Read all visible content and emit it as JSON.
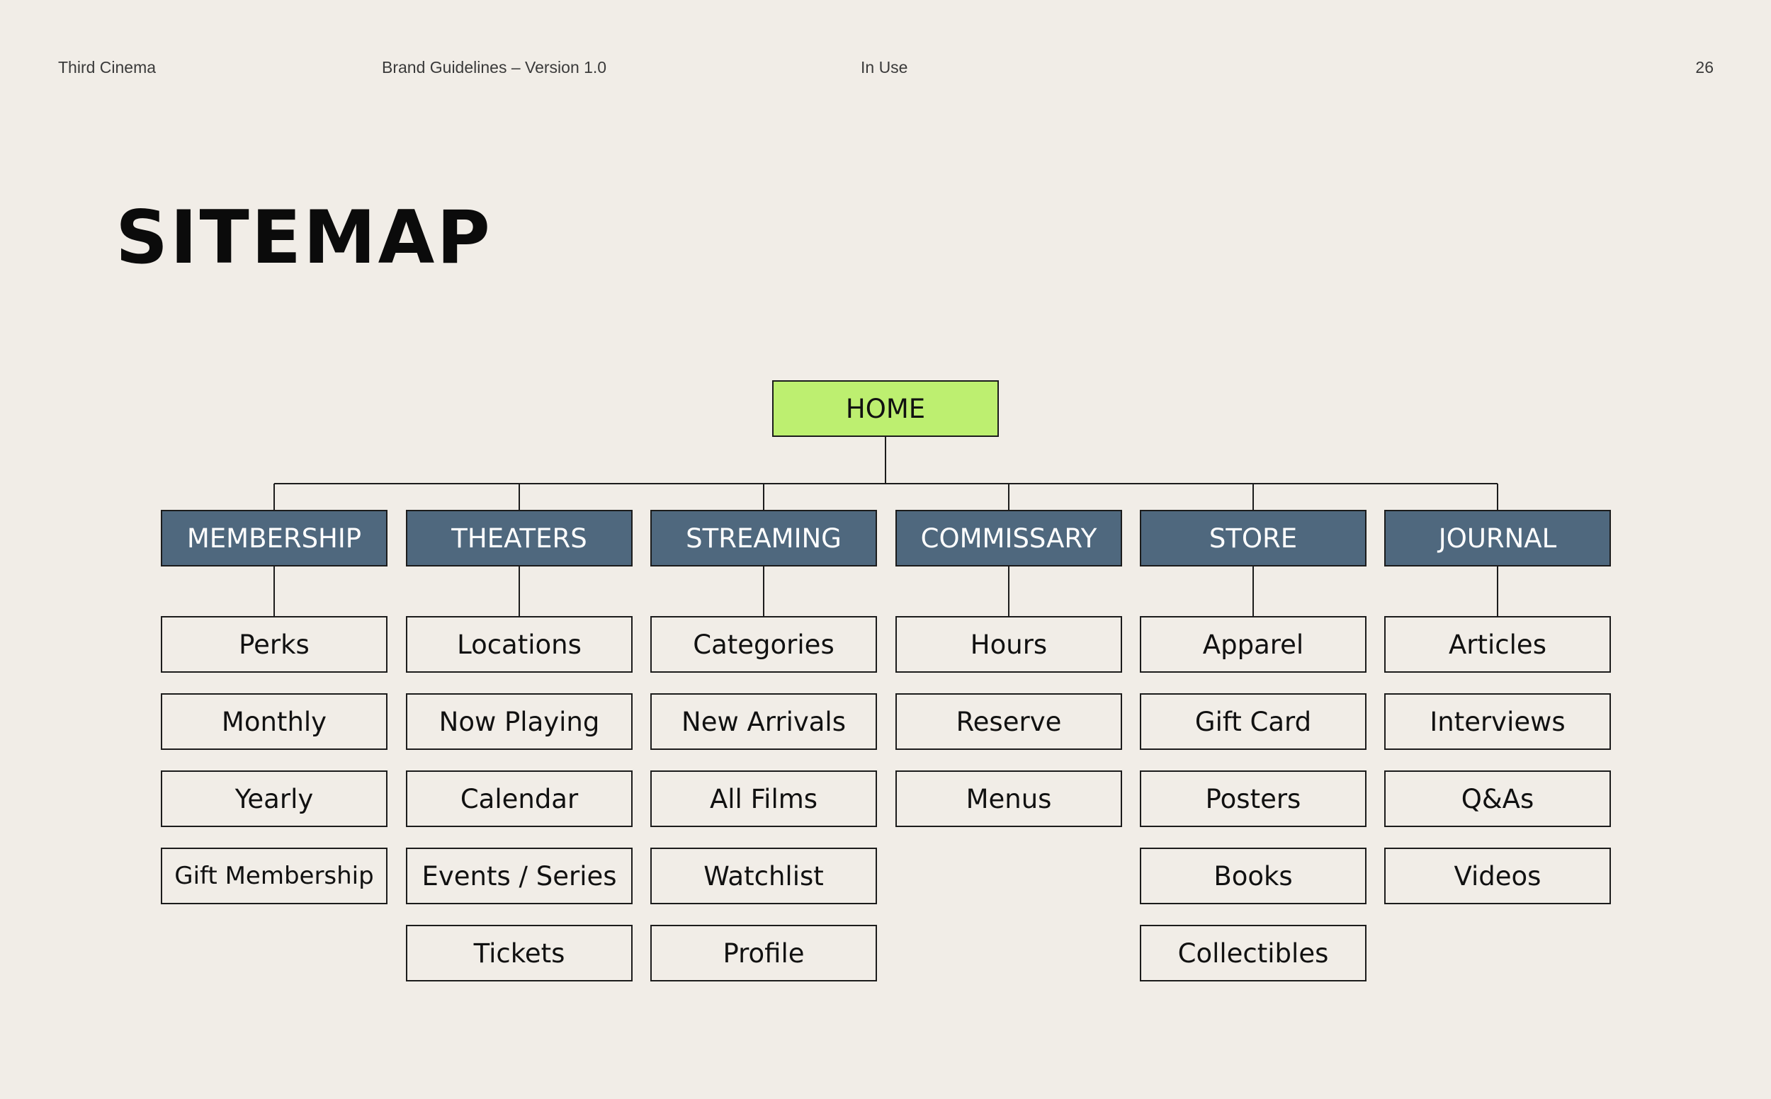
{
  "header": {
    "brand": "Third Cinema",
    "guidelines": "Brand Guidelines  –  Version 1.0",
    "section": "In Use",
    "page_number": "26"
  },
  "title": "SITEMAP",
  "colors": {
    "background": "#f1ede7",
    "root_fill": "#bdef70",
    "section_fill": "#4f687e",
    "line": "#1c1c1c"
  },
  "sitemap": {
    "root": "HOME",
    "sections": [
      {
        "label": "MEMBERSHIP",
        "pages": [
          "Perks",
          "Monthly",
          "Yearly",
          "Gift Membership"
        ]
      },
      {
        "label": "THEATERS",
        "pages": [
          "Locations",
          "Now Playing",
          "Calendar",
          "Events / Series",
          "Tickets"
        ]
      },
      {
        "label": "STREAMING",
        "pages": [
          "Categories",
          "New Arrivals",
          "All Films",
          "Watchlist",
          "Profile"
        ]
      },
      {
        "label": "COMMISSARY",
        "pages": [
          "Hours",
          "Reserve",
          "Menus"
        ]
      },
      {
        "label": "STORE",
        "pages": [
          "Apparel",
          "Gift Card",
          "Posters",
          "Books",
          "Collectibles"
        ]
      },
      {
        "label": "JOURNAL",
        "pages": [
          "Articles",
          "Interviews",
          "Q&As",
          "Videos"
        ]
      }
    ]
  }
}
